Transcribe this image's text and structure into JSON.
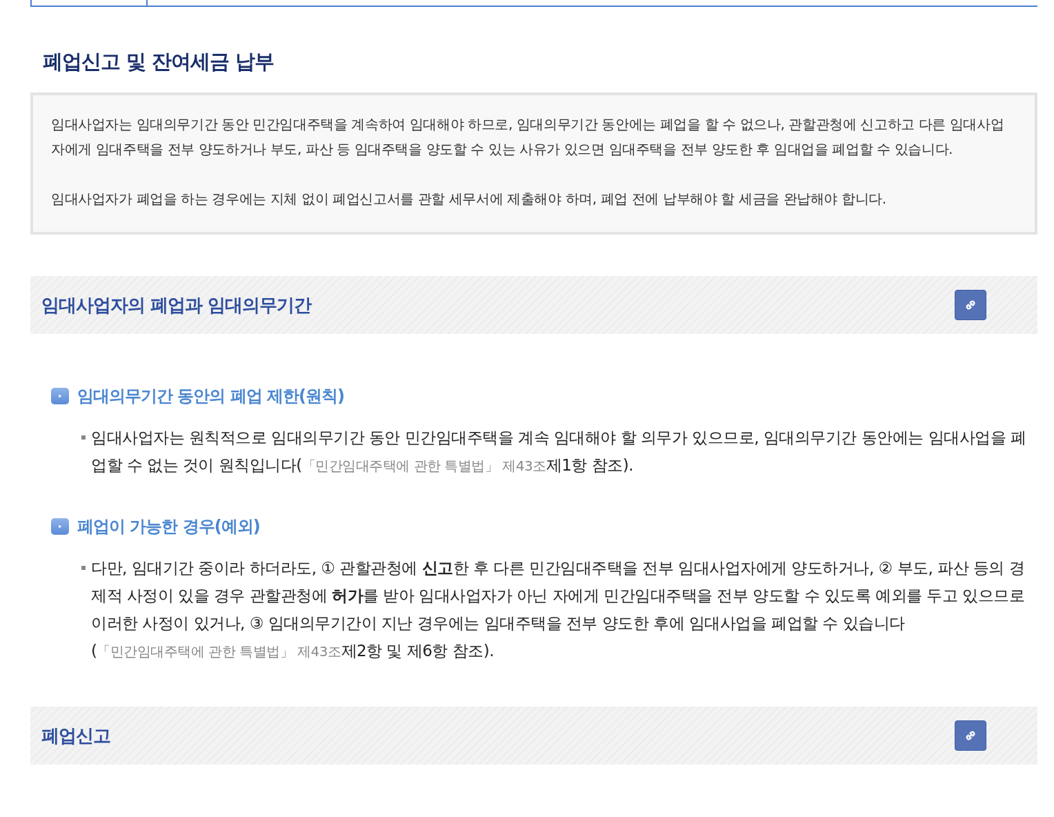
{
  "page_title": "폐업신고 및 잔여세금 납부",
  "intro": [
    "임대사업자는 임대의무기간 동안 민간임대주택을 계속하여 임대해야 하므로, 임대의무기간 동안에는 폐업을 할 수 없으나, 관할관청에 신고하고 다른 임대사업자에게 임대주택을 전부 양도하거나 부도, 파산 등 임대주택을 양도할 수 있는 사유가 있으면 임대주택을 전부 양도한 후 임대업을 폐업할 수 있습니다.",
    "임대사업자가 폐업을 하는 경우에는 지체 없이 폐업신고서를 관할 세무서에 제출해야 하며, 폐업 전에 납부해야 할 세금을 완납해야 합니다."
  ],
  "sections": [
    {
      "title": "임대사업자의 폐업과 임대의무기간",
      "subsections": [
        {
          "title": "임대의무기간 동안의 폐업 제한(원칙)",
          "parts": [
            {
              "kind": "text",
              "text": "임대사업자는 원칙적으로 임대의무기간 동안 민간임대주택을 계속 임대해야 할 의무가 있으므로, 임대의무기간 동안에는 임대사업을 폐업할 수 없는 것이 원칙입니다("
            },
            {
              "kind": "link",
              "text": "「민간임대주택에 관한 특별법」 제43조"
            },
            {
              "kind": "text",
              "text": "제1항 참조)."
            }
          ]
        },
        {
          "title": "폐업이 가능한 경우(예외)",
          "parts": [
            {
              "kind": "text",
              "text": "다만, 임대기간 중이라 하더라도, ① 관할관청에 **신고**한 후 다른 민간임대주택을 전부 임대사업자에게 양도하거나, ② 부도, 파산 등의 경제적 사정이 있을 경우 관할관청에 **허가**를 받아 임대사업자가 아닌 자에게 민간임대주택을 전부 양도할 수 있도록 예외를 두고 있으므로 이러한 사정이 있거나, ③ 임대의무기간이 지난 경우에는 임대주택을 전부 양도한 후에 임대사업을 폐업할 수 있습니다("
            },
            {
              "kind": "link",
              "text": "「민간임대주택에 관한 특별법」 제43조"
            },
            {
              "kind": "text",
              "text": "제2항 및 제6항 참조)."
            }
          ]
        }
      ]
    },
    {
      "title": "폐업신고"
    }
  ]
}
